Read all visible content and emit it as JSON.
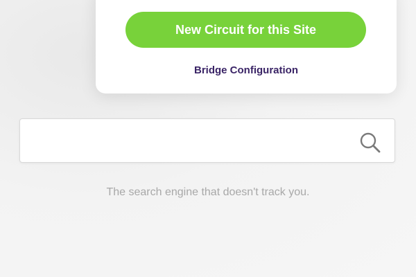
{
  "popup": {
    "new_circuit_label": "New Circuit for this Site",
    "bridge_label": "Bridge Configuration"
  },
  "search": {
    "value": "",
    "placeholder": "",
    "icon": "search-icon"
  },
  "tagline": "The search engine that doesn't track you.",
  "colors": {
    "accent_green": "#78d23a",
    "link_purple": "#3a2466",
    "tagline_gray": "#a8a8a8",
    "background": "#f4f4f4"
  }
}
